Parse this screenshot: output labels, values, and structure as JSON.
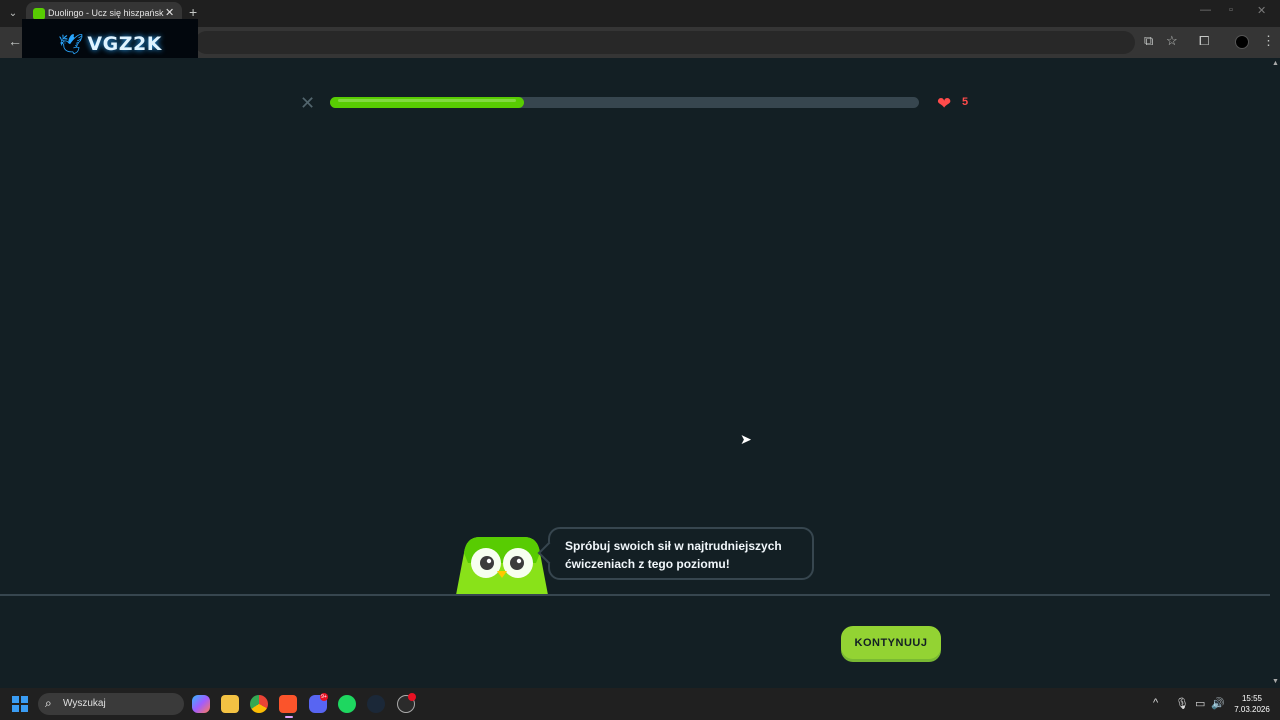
{
  "browser": {
    "tab_title": "Duolingo - Ucz się hiszpańskiego",
    "overlay_logo": "VGZ2K"
  },
  "lesson": {
    "progress": 0.33,
    "hearts": "5",
    "speech": "Spróbuj swoich sił w najtrudniejszych ćwiczeniach z tego poziomu!",
    "continue_label": "KONTYNUUJ"
  },
  "colors": {
    "progress_fill": "#58cc02",
    "heart": "#ff4b4b",
    "button": "#93d333"
  },
  "taskbar": {
    "search_placeholder": "Wyszukaj",
    "discord_badge": "9+",
    "time": "15:55",
    "date": "7.03.2026"
  }
}
